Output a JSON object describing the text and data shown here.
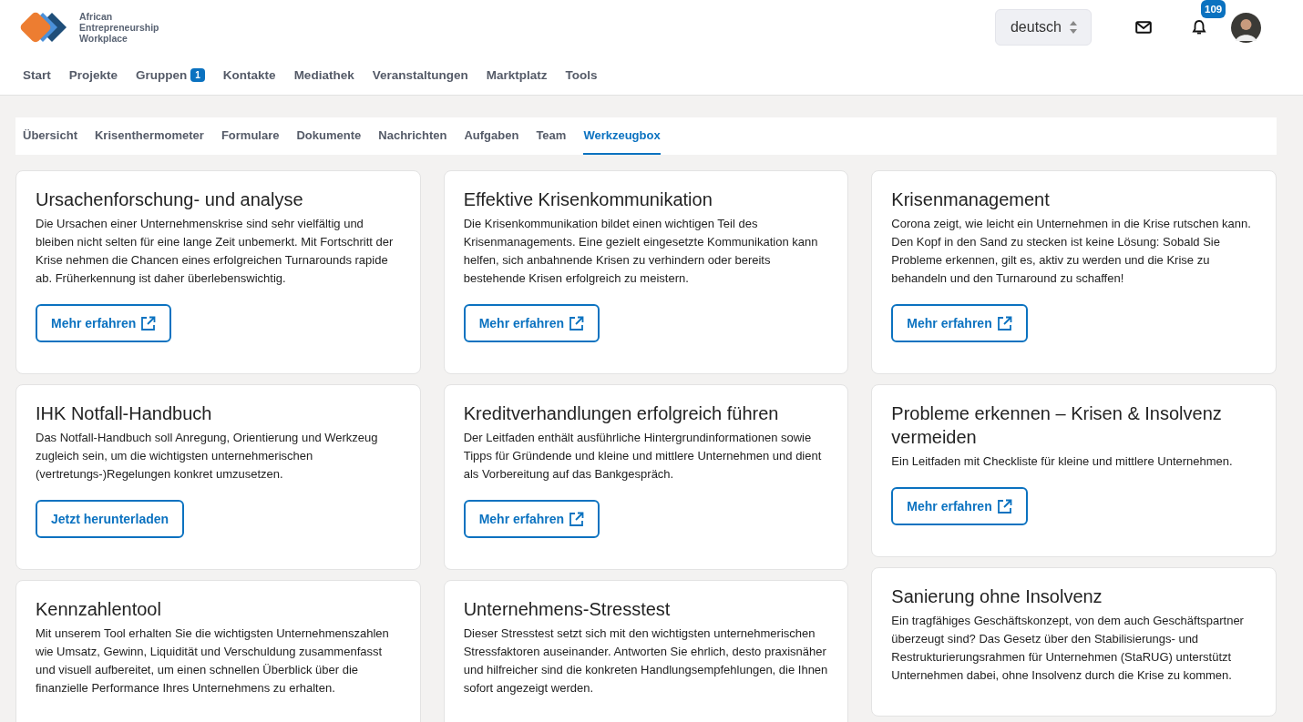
{
  "logo": {
    "lines": [
      "African",
      "Entrepreneurship",
      "Workplace"
    ]
  },
  "language": {
    "value": "deutsch"
  },
  "notifications": {
    "count": "109"
  },
  "main_nav": [
    {
      "label": "Start",
      "selected": false
    },
    {
      "label": "Projekte",
      "selected": false
    },
    {
      "label": "Gruppen",
      "selected": false,
      "badge": "1"
    },
    {
      "label": "Kontakte",
      "selected": false
    },
    {
      "label": "Mediathek",
      "selected": false
    },
    {
      "label": "Veranstaltungen",
      "selected": false
    },
    {
      "label": "Marktplatz",
      "selected": false
    },
    {
      "label": "Tools",
      "selected": false
    }
  ],
  "tabs": [
    {
      "label": "Übersicht",
      "selected": false
    },
    {
      "label": "Krisenthermometer",
      "selected": false
    },
    {
      "label": "Formulare",
      "selected": false
    },
    {
      "label": "Dokumente",
      "selected": false
    },
    {
      "label": "Nachrichten",
      "selected": false
    },
    {
      "label": "Aufgaben",
      "selected": false
    },
    {
      "label": "Team",
      "selected": false
    },
    {
      "label": "Werkzeugbox",
      "selected": true
    }
  ],
  "columns": [
    [
      {
        "title": "Ursachenforschung- und analyse",
        "text": "Die Ursachen einer Unternehmenskrise sind sehr vielfältig und bleiben nicht selten für eine lange Zeit unbemerkt. Mit Fortschritt der Krise nehmen die Chancen eines erfolgreichen Turnarounds rapide ab. Früherkennung ist daher überlebenswichtig.",
        "button": {
          "label": "Mehr erfahren",
          "kind": "external"
        }
      },
      {
        "title": "IHK Notfall-Handbuch",
        "text": "Das Notfall-Handbuch soll Anregung, Orientierung und Werkzeug zugleich sein, um die wichtigsten unternehmerischen (vertretungs-)Regelungen konkret umzusetzen.",
        "button": {
          "label": "Jetzt herunterladen",
          "kind": "plain"
        }
      },
      {
        "title": "Kennzahlentool",
        "text": "Mit unserem Tool erhalten Sie die wichtigsten Unternehmenszahlen wie Umsatz, Gewinn, Liquidität und Verschuldung zusammenfasst und visuell aufbereitet, um einen schnellen Überblick über die finanzielle Performance Ihres Unternehmens zu erhalten."
      }
    ],
    [
      {
        "title": "Effektive Krisenkommunikation",
        "text": "Die Krisenkommunikation bildet einen wichtigen Teil des Krisenmanagements. Eine gezielt eingesetzte Kommunikation kann helfen, sich anbahnende Krisen zu verhindern oder bereits bestehende Krisen erfolgreich zu meistern.",
        "button": {
          "label": "Mehr erfahren",
          "kind": "external"
        }
      },
      {
        "title": "Kreditverhandlungen erfolgreich führen",
        "text": "Der Leitfaden enthält ausführliche Hintergrundinformationen sowie Tipps für Gründende und kleine und mittlere Unternehmen und dient als Vorbereitung auf das Bankgespräch.",
        "button": {
          "label": "Mehr erfahren",
          "kind": "external"
        }
      },
      {
        "title": "Unternehmens-Stresstest",
        "text": "Dieser Stresstest setzt sich mit den wichtigsten unternehmerischen Stressfaktoren auseinander. Antworten Sie ehrlich, desto praxisnäher und hilfreicher sind die konkreten Handlungsempfehlungen, die Ihnen sofort angezeigt werden."
      }
    ],
    [
      {
        "title": "Krisenmanagement",
        "text": "Corona zeigt, wie leicht ein Unternehmen in die Krise rutschen kann. Den Kopf in den Sand zu stecken ist keine Lösung: Sobald Sie Probleme erkennen, gilt es, aktiv zu werden und die Krise zu behandeln und den Turnaround zu schaffen!",
        "button": {
          "label": "Mehr erfahren",
          "kind": "external"
        }
      },
      {
        "title": "Probleme erkennen – Krisen & Insolvenz vermeiden",
        "text": "Ein Leitfaden mit Checkliste für kleine und mittlere Unternehmen.",
        "button": {
          "label": "Mehr erfahren",
          "kind": "external"
        }
      },
      {
        "title": "Sanierung ohne Insolvenz",
        "text": "Ein tragfähiges Geschäftskonzept, von dem auch Geschäftspartner überzeugt sind? Das Gesetz über den Stabilisierungs- und Restrukturierungsrahmen für Unternehmen (StaRUG) unterstützt Unternehmen dabei, ohne Insolvenz durch die Krise zu kommen."
      }
    ]
  ]
}
